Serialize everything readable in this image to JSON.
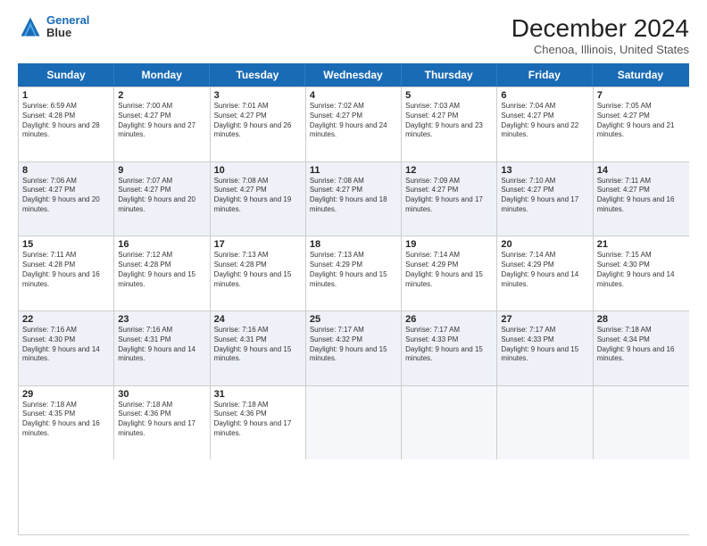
{
  "header": {
    "logo": {
      "line1": "General",
      "line2": "Blue"
    },
    "title": "December 2024",
    "subtitle": "Chenoa, Illinois, United States"
  },
  "calendar": {
    "days": [
      "Sunday",
      "Monday",
      "Tuesday",
      "Wednesday",
      "Thursday",
      "Friday",
      "Saturday"
    ],
    "weeks": [
      [
        {
          "day": "",
          "empty": true
        },
        {
          "day": "",
          "empty": true
        },
        {
          "day": "",
          "empty": true
        },
        {
          "day": "",
          "empty": true
        },
        {
          "day": "",
          "empty": true
        },
        {
          "day": "",
          "empty": true
        },
        {
          "day": "",
          "empty": true
        }
      ],
      [
        {
          "num": "1",
          "sunrise": "6:59 AM",
          "sunset": "4:28 PM",
          "daylight": "9 hours and 28 minutes."
        },
        {
          "num": "2",
          "sunrise": "7:00 AM",
          "sunset": "4:27 PM",
          "daylight": "9 hours and 27 minutes."
        },
        {
          "num": "3",
          "sunrise": "7:01 AM",
          "sunset": "4:27 PM",
          "daylight": "9 hours and 26 minutes."
        },
        {
          "num": "4",
          "sunrise": "7:02 AM",
          "sunset": "4:27 PM",
          "daylight": "9 hours and 24 minutes."
        },
        {
          "num": "5",
          "sunrise": "7:03 AM",
          "sunset": "4:27 PM",
          "daylight": "9 hours and 23 minutes."
        },
        {
          "num": "6",
          "sunrise": "7:04 AM",
          "sunset": "4:27 PM",
          "daylight": "9 hours and 22 minutes."
        },
        {
          "num": "7",
          "sunrise": "7:05 AM",
          "sunset": "4:27 PM",
          "daylight": "9 hours and 21 minutes."
        }
      ],
      [
        {
          "num": "8",
          "sunrise": "7:06 AM",
          "sunset": "4:27 PM",
          "daylight": "9 hours and 20 minutes."
        },
        {
          "num": "9",
          "sunrise": "7:07 AM",
          "sunset": "4:27 PM",
          "daylight": "9 hours and 20 minutes."
        },
        {
          "num": "10",
          "sunrise": "7:08 AM",
          "sunset": "4:27 PM",
          "daylight": "9 hours and 19 minutes."
        },
        {
          "num": "11",
          "sunrise": "7:08 AM",
          "sunset": "4:27 PM",
          "daylight": "9 hours and 18 minutes."
        },
        {
          "num": "12",
          "sunrise": "7:09 AM",
          "sunset": "4:27 PM",
          "daylight": "9 hours and 17 minutes."
        },
        {
          "num": "13",
          "sunrise": "7:10 AM",
          "sunset": "4:27 PM",
          "daylight": "9 hours and 17 minutes."
        },
        {
          "num": "14",
          "sunrise": "7:11 AM",
          "sunset": "4:27 PM",
          "daylight": "9 hours and 16 minutes."
        }
      ],
      [
        {
          "num": "15",
          "sunrise": "7:11 AM",
          "sunset": "4:28 PM",
          "daylight": "9 hours and 16 minutes."
        },
        {
          "num": "16",
          "sunrise": "7:12 AM",
          "sunset": "4:28 PM",
          "daylight": "9 hours and 15 minutes."
        },
        {
          "num": "17",
          "sunrise": "7:13 AM",
          "sunset": "4:28 PM",
          "daylight": "9 hours and 15 minutes."
        },
        {
          "num": "18",
          "sunrise": "7:13 AM",
          "sunset": "4:29 PM",
          "daylight": "9 hours and 15 minutes."
        },
        {
          "num": "19",
          "sunrise": "7:14 AM",
          "sunset": "4:29 PM",
          "daylight": "9 hours and 15 minutes."
        },
        {
          "num": "20",
          "sunrise": "7:14 AM",
          "sunset": "4:29 PM",
          "daylight": "9 hours and 14 minutes."
        },
        {
          "num": "21",
          "sunrise": "7:15 AM",
          "sunset": "4:30 PM",
          "daylight": "9 hours and 14 minutes."
        }
      ],
      [
        {
          "num": "22",
          "sunrise": "7:16 AM",
          "sunset": "4:30 PM",
          "daylight": "9 hours and 14 minutes."
        },
        {
          "num": "23",
          "sunrise": "7:16 AM",
          "sunset": "4:31 PM",
          "daylight": "9 hours and 14 minutes."
        },
        {
          "num": "24",
          "sunrise": "7:16 AM",
          "sunset": "4:31 PM",
          "daylight": "9 hours and 15 minutes."
        },
        {
          "num": "25",
          "sunrise": "7:17 AM",
          "sunset": "4:32 PM",
          "daylight": "9 hours and 15 minutes."
        },
        {
          "num": "26",
          "sunrise": "7:17 AM",
          "sunset": "4:33 PM",
          "daylight": "9 hours and 15 minutes."
        },
        {
          "num": "27",
          "sunrise": "7:17 AM",
          "sunset": "4:33 PM",
          "daylight": "9 hours and 15 minutes."
        },
        {
          "num": "28",
          "sunrise": "7:18 AM",
          "sunset": "4:34 PM",
          "daylight": "9 hours and 16 minutes."
        }
      ],
      [
        {
          "num": "29",
          "sunrise": "7:18 AM",
          "sunset": "4:35 PM",
          "daylight": "9 hours and 16 minutes."
        },
        {
          "num": "30",
          "sunrise": "7:18 AM",
          "sunset": "4:36 PM",
          "daylight": "9 hours and 17 minutes."
        },
        {
          "num": "31",
          "sunrise": "7:18 AM",
          "sunset": "4:36 PM",
          "daylight": "9 hours and 17 minutes."
        },
        {
          "empty": true
        },
        {
          "empty": true
        },
        {
          "empty": true
        },
        {
          "empty": true
        }
      ]
    ]
  }
}
